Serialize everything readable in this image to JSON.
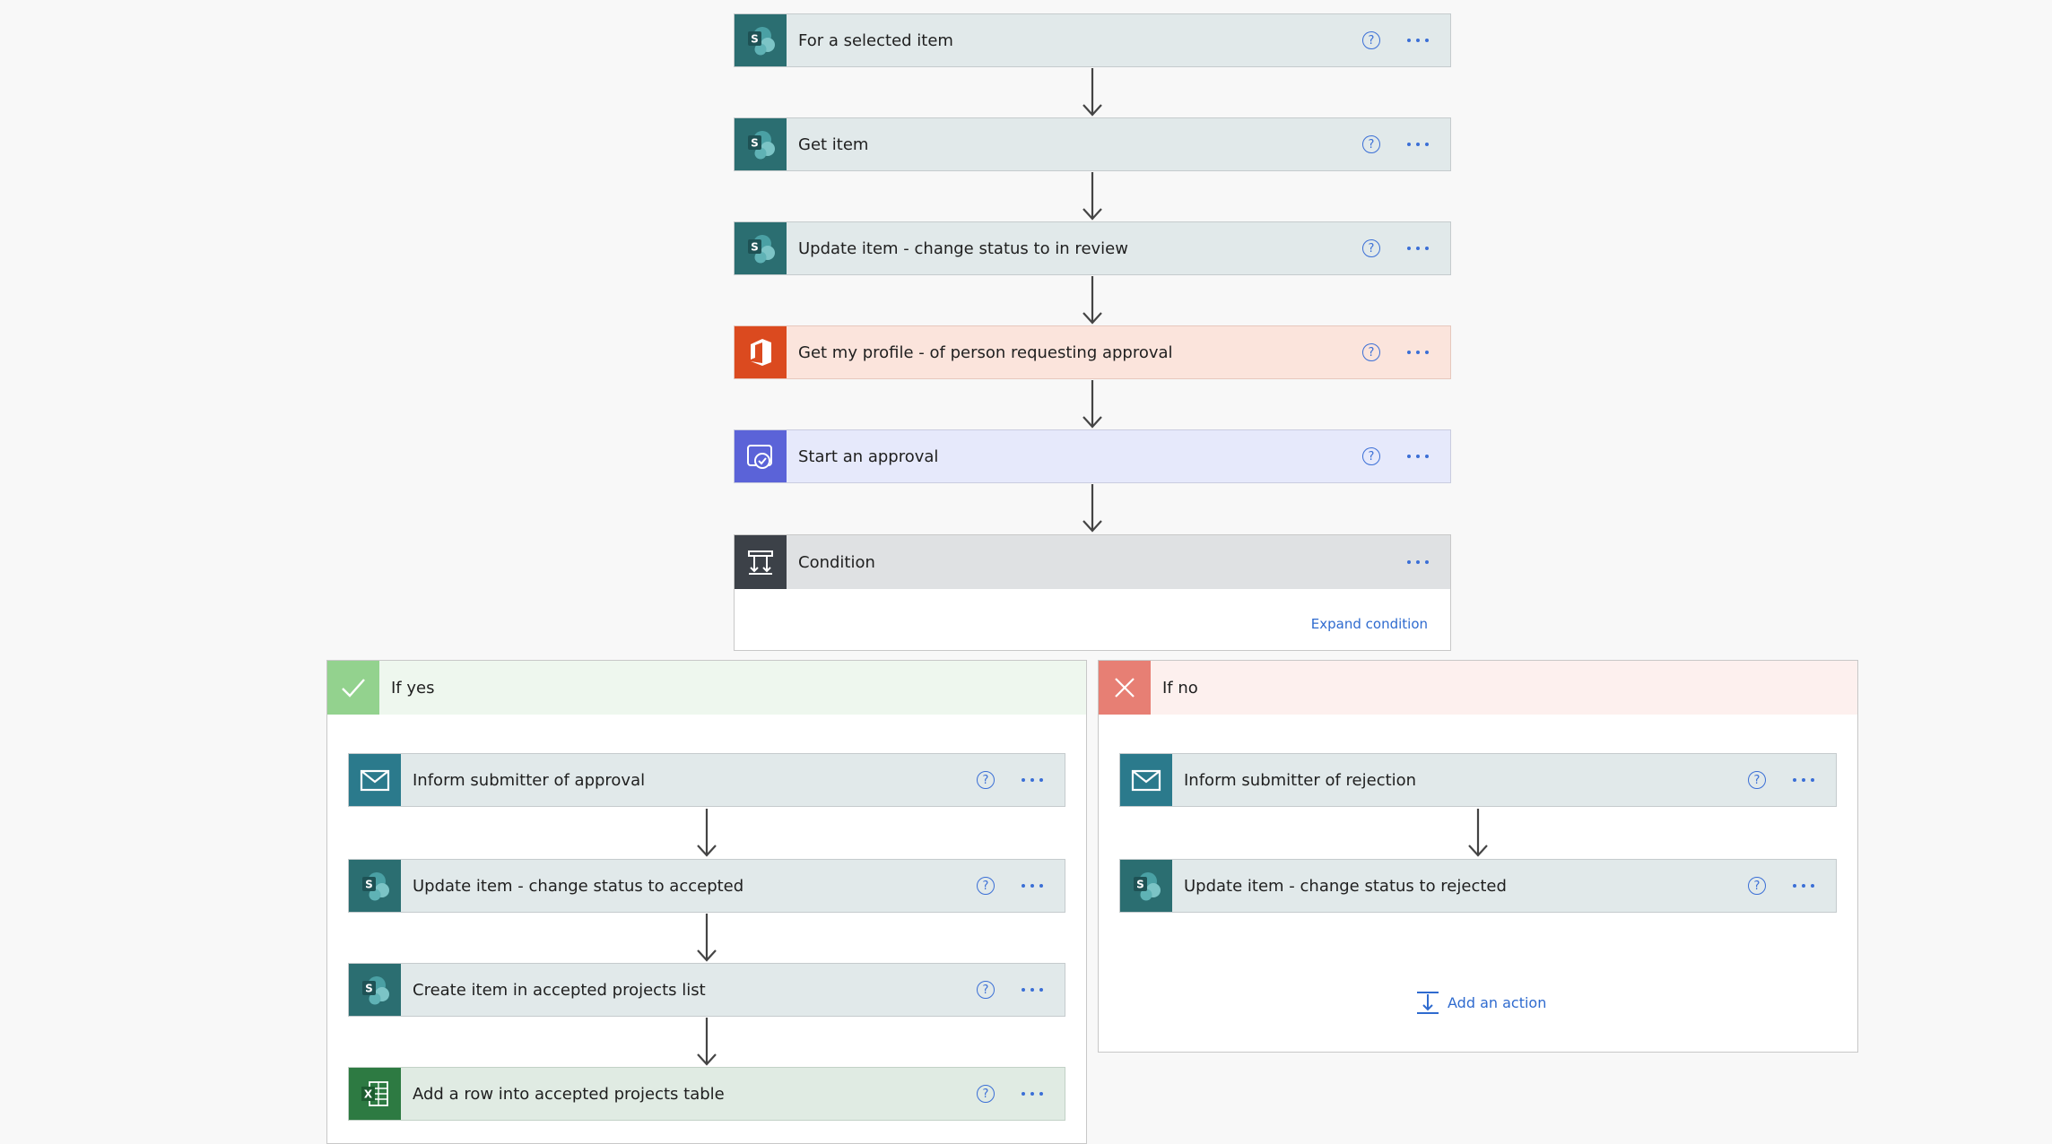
{
  "steps": {
    "s1": "For a selected item",
    "s2": "Get item",
    "s3": "Update item - change status to in review",
    "s4": "Get my profile - of person requesting approval",
    "s5": "Start an approval"
  },
  "condition": {
    "label": "Condition",
    "expand_label": "Expand condition"
  },
  "yes_branch": {
    "label": "If yes",
    "actions": [
      "Inform submitter of approval",
      "Update item - change status to accepted",
      "Create item in accepted projects list",
      "Add a row into accepted projects table"
    ]
  },
  "no_branch": {
    "label": "If no",
    "actions": [
      "Inform submitter of rejection",
      "Update item - change status to rejected"
    ],
    "add_action_label": "Add an action"
  },
  "help_glyph": "?",
  "colors": {
    "sharepoint": "#2b6e71",
    "office": "#db4a1f",
    "approvals": "#5b63d8",
    "condition": "#3c4148",
    "mail": "#2b7a8c",
    "excel": "#2d7a42",
    "yes": "#93d28e",
    "no": "#e77f74",
    "link": "#2f6bcf"
  }
}
